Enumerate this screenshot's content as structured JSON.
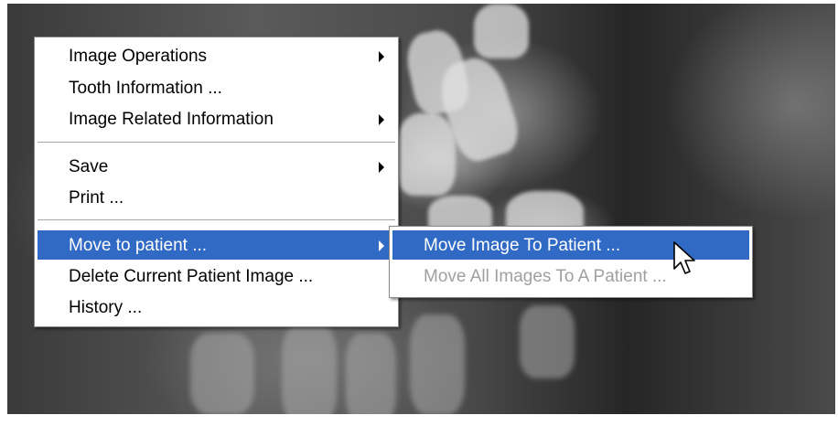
{
  "context_menu": {
    "items": [
      {
        "label": "Image Operations",
        "has_submenu": true
      },
      {
        "label": "Tooth Information ...",
        "has_submenu": false
      },
      {
        "label": "Image Related Information",
        "has_submenu": true
      },
      {
        "label": "Save",
        "has_submenu": true
      },
      {
        "label": "Print ...",
        "has_submenu": false
      },
      {
        "label": "Move to patient ...",
        "has_submenu": true,
        "highlighted": true
      },
      {
        "label": "Delete Current Patient Image ...",
        "has_submenu": false
      },
      {
        "label": "History ...",
        "has_submenu": false
      }
    ]
  },
  "submenu": {
    "items": [
      {
        "label": "Move Image To Patient ...",
        "highlighted": true,
        "enabled": true
      },
      {
        "label": "Move All Images To A Patient ...",
        "enabled": false
      }
    ]
  },
  "colors": {
    "highlight": "#316ac5",
    "disabled_text": "#a0a0a0",
    "menu_background": "#ffffff"
  },
  "icons": {
    "submenu_arrow": "chevron-right-icon",
    "pointer": "mouse-pointer-icon"
  }
}
